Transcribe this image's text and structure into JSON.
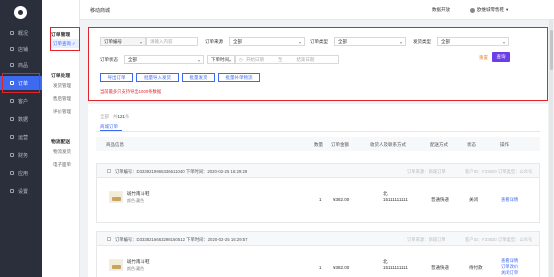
{
  "header": {
    "title": "移动商城",
    "help": "数据开放",
    "user": "欧维城零售鞋"
  },
  "rail": {
    "items": [
      {
        "label": "概况"
      },
      {
        "label": "店铺"
      },
      {
        "label": "商品"
      },
      {
        "label": "订单",
        "active": true
      },
      {
        "label": "客户"
      },
      {
        "label": "数据"
      },
      {
        "label": "运营"
      },
      {
        "label": "财务"
      },
      {
        "label": "应用"
      },
      {
        "label": "设置"
      }
    ]
  },
  "sub": {
    "section1": "订单管理",
    "current": "订单查询",
    "section2": "订单处理",
    "links2": [
      "发货管理",
      "售后管理",
      "评价管理"
    ],
    "section3": "物流配送",
    "links3": [
      "物流发货",
      "电子面单"
    ]
  },
  "filter": {
    "order_no_select": "订单编号",
    "order_no_placeholder": "请输入内容",
    "order_source_label": "订单来源",
    "order_source_value": "全部",
    "order_type_label": "订单类型",
    "order_type_value": "全部",
    "ship_type_label": "发货类型",
    "ship_type_value": "全部",
    "order_status_label": "订单状态",
    "order_status_value": "全部",
    "time_select": "下单时间",
    "start_placeholder": "开始日期",
    "to_text": "至",
    "end_placeholder": "结束日期",
    "reset": "重置",
    "query": "查询",
    "buttons": [
      "导出订单",
      "批量导入发货",
      "批量发货",
      "批量补单物流"
    ],
    "warning": "当前最多只支持导出1000条数据"
  },
  "main": {
    "tab_all": "全部",
    "tab_count_prefix": "共",
    "tab_count": "121",
    "tab_count_suffix": "条",
    "tab_shop": "商城订单",
    "columns": [
      "商品信息",
      "数量",
      "订单金额",
      "收货人及联系方式",
      "配送方式",
      "状态",
      "操作"
    ]
  },
  "orders": [
    {
      "no": "订单编号：D3339219965336611040 下单时间：2020-02-25 16:29:29",
      "source": "订单来源：商城订单",
      "dealer": "客户ID：F33820 订单类型：公众号",
      "product": "斑竹南斗鞋",
      "spec": "颜色:藏色",
      "qty": "1",
      "amount": "¥382.00",
      "receiver": "北",
      "phone": "15111111111",
      "delivery": "普通快递",
      "status": "关闭",
      "actions": [
        "查看详情"
      ]
    },
    {
      "no": "订单编号：D3338216663298160512 下单时间：2020-02-25 16:29:57",
      "source": "订单来源：商城订单",
      "dealer": "客户ID：F33820 订单类型：公众号",
      "product": "斑竹南斗鞋",
      "spec": "颜色:藏色",
      "qty": "1",
      "amount": "¥382.00",
      "receiver": "北",
      "phone": "15111111111",
      "delivery": "普通快递",
      "status": "待付款",
      "actions": [
        "查看详情",
        "订单改价",
        "关闭订单"
      ]
    }
  ]
}
